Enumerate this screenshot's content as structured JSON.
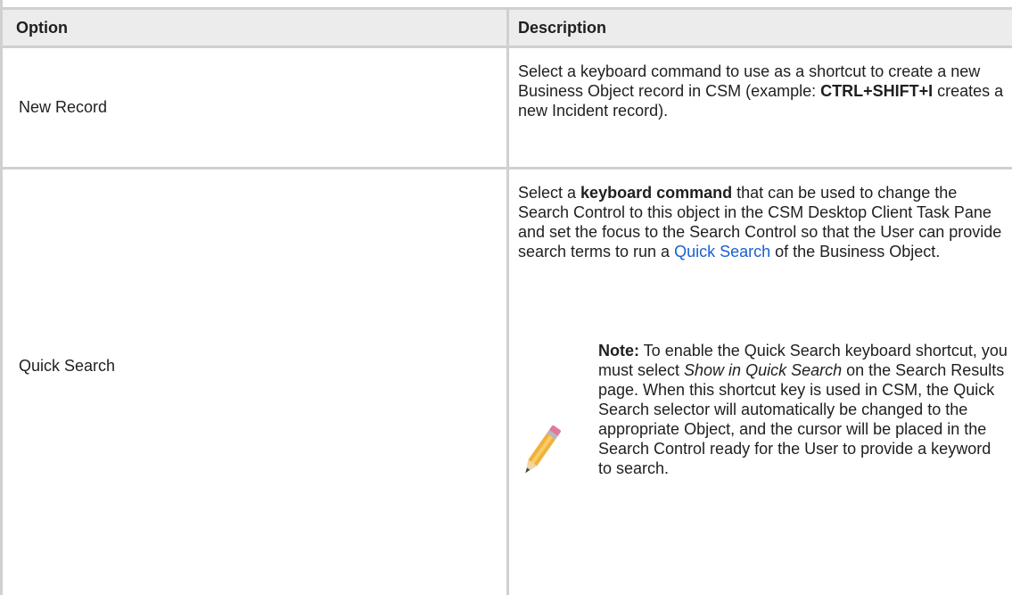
{
  "table": {
    "headers": {
      "option": "Option",
      "description": "Description"
    },
    "rows": [
      {
        "option": "New Record",
        "desc_1": "Select a keyboard command to use as a shortcut to create a new Business Object record in CSM (example: ",
        "desc_bold": "CTRL+SHIFT+I",
        "desc_2": " creates a new Incident record)."
      },
      {
        "option": "Quick Search",
        "desc_1": "Select a ",
        "desc_bold": "keyboard command",
        "desc_2": " that can be used to change the Search Control to this object in the CSM Desktop Client Task Pane and set the focus to the Search Control so that the User can provide search terms to run a ",
        "desc_link": "Quick Search",
        "desc_3": " of the Business Object.",
        "note": {
          "label": "Note:",
          "text_1": " To enable the Quick Search keyboard shortcut, you must select ",
          "text_italic": "Show in Quick Search",
          "text_2": " on the Search Results page. When this shortcut key is used in CSM, the Quick Search selector will automatically be changed to the appropriate Object, and the cursor will be placed in the Search Control ready for the User to provide a keyword to search.",
          "icon": "pencil-icon"
        }
      }
    ]
  },
  "colors": {
    "border": "#d0d0d0",
    "header_bg": "#ececec",
    "link": "#1a5fd1"
  }
}
